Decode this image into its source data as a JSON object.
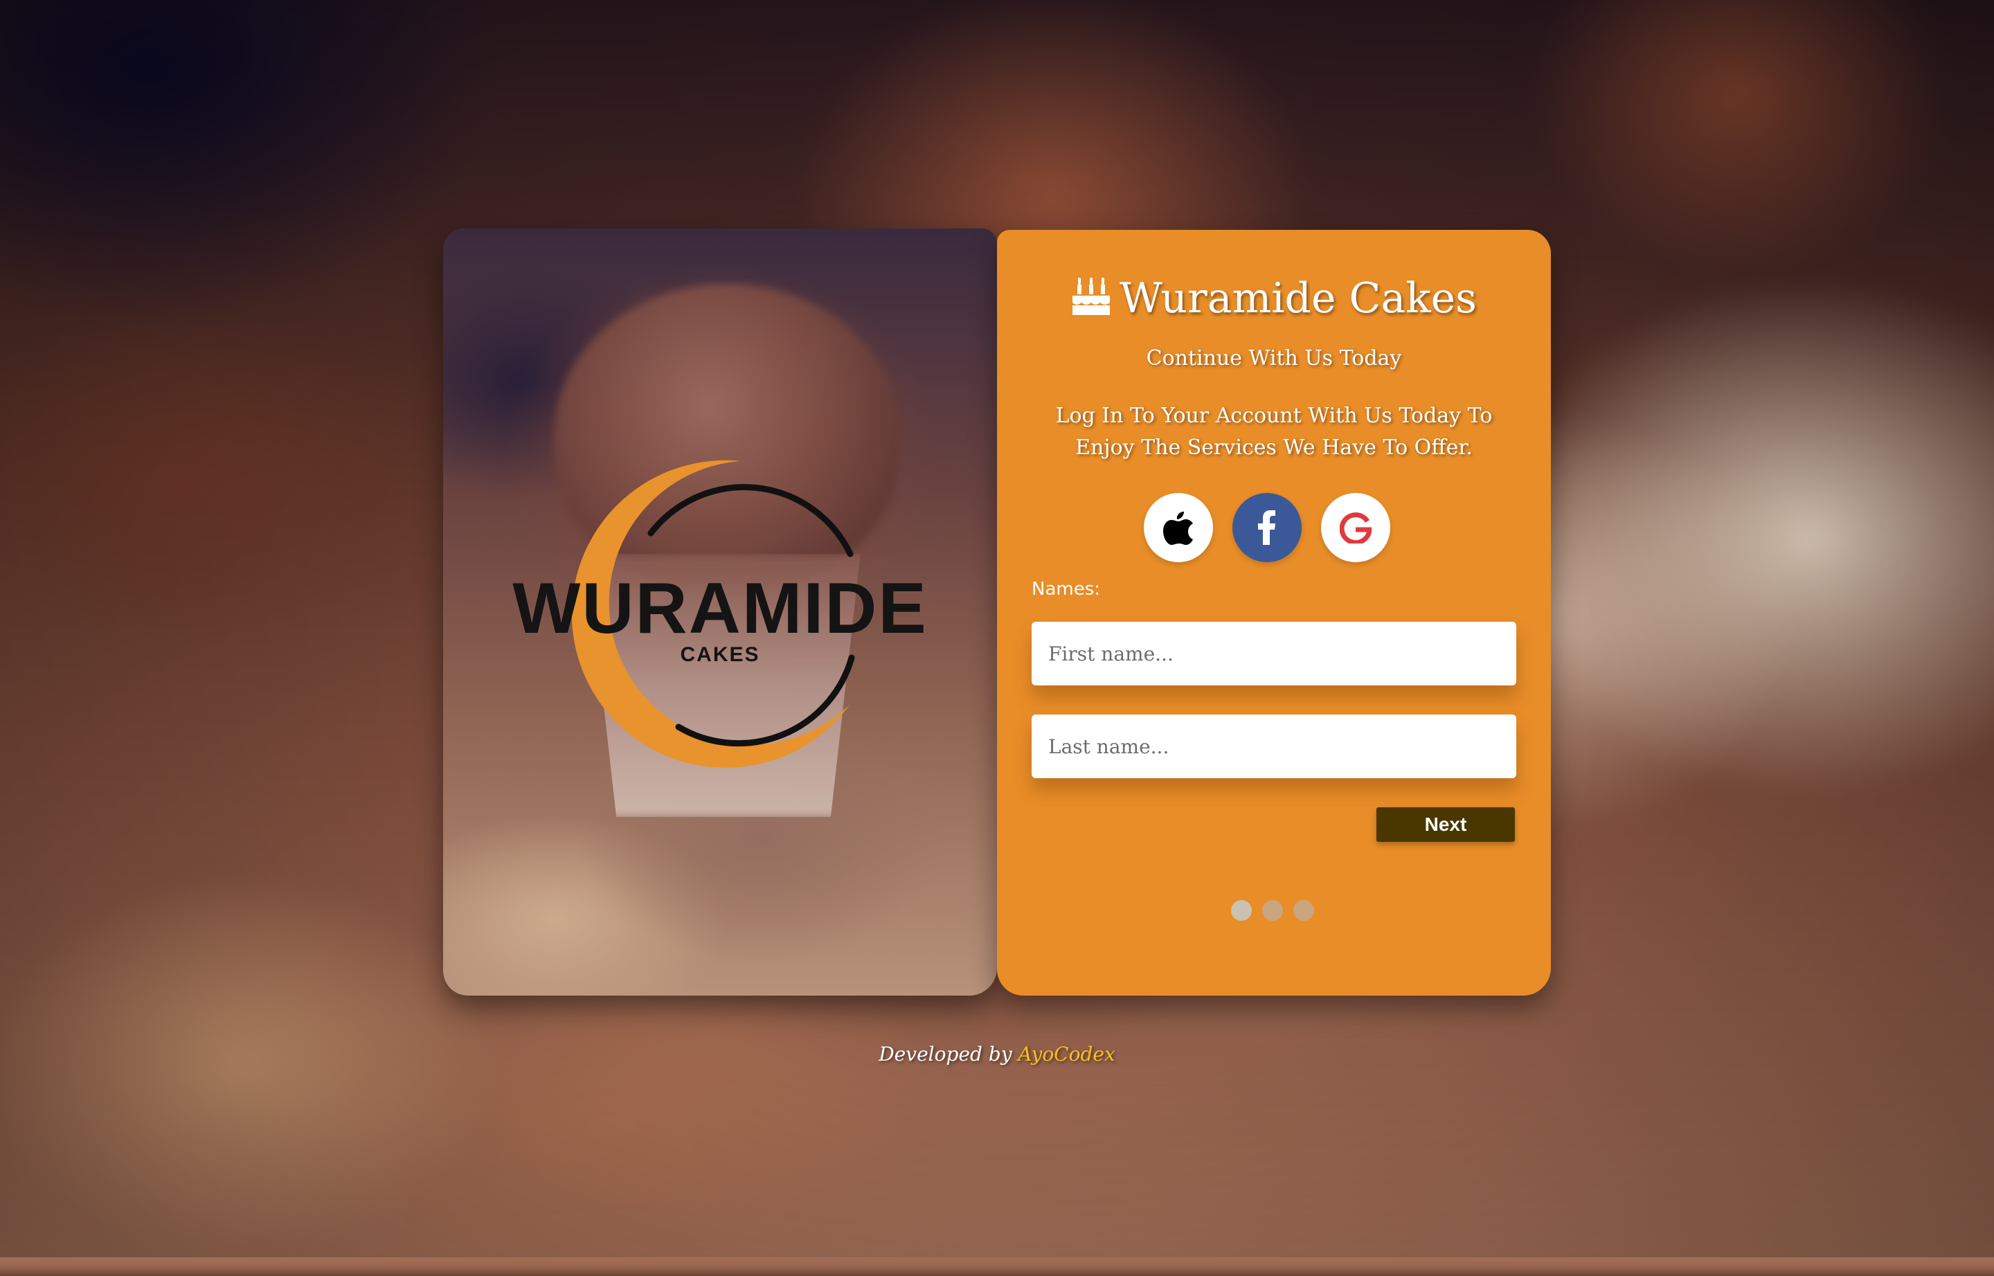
{
  "brand": {
    "title": "Wuramide Cakes",
    "icon": "birthday-cake-icon",
    "logo_text": "WURAMIDE",
    "logo_subtext": "CAKES"
  },
  "form": {
    "subtitle": "Continue With Us Today",
    "description": "Log In To Your Account With Us Today To Enjoy The Services We Have To Offer.",
    "social": [
      {
        "name": "apple",
        "icon": "apple-icon"
      },
      {
        "name": "facebook",
        "icon": "facebook-icon"
      },
      {
        "name": "google",
        "icon": "google-icon"
      }
    ],
    "names_label": "Names:",
    "first_name_placeholder": "First name...",
    "last_name_placeholder": "Last name...",
    "first_name_value": "",
    "last_name_value": "",
    "next_label": "Next",
    "steps_total": 3,
    "step_active": 1
  },
  "footer": {
    "prefix": "Developed by",
    "author": "AyoCodex"
  },
  "colors": {
    "card": "#e88d28",
    "next_button": "#4a3700",
    "facebook": "#3b5998",
    "google_red": "#e0393e",
    "author": "#f6c01c",
    "logo_orange": "#e8932d"
  }
}
